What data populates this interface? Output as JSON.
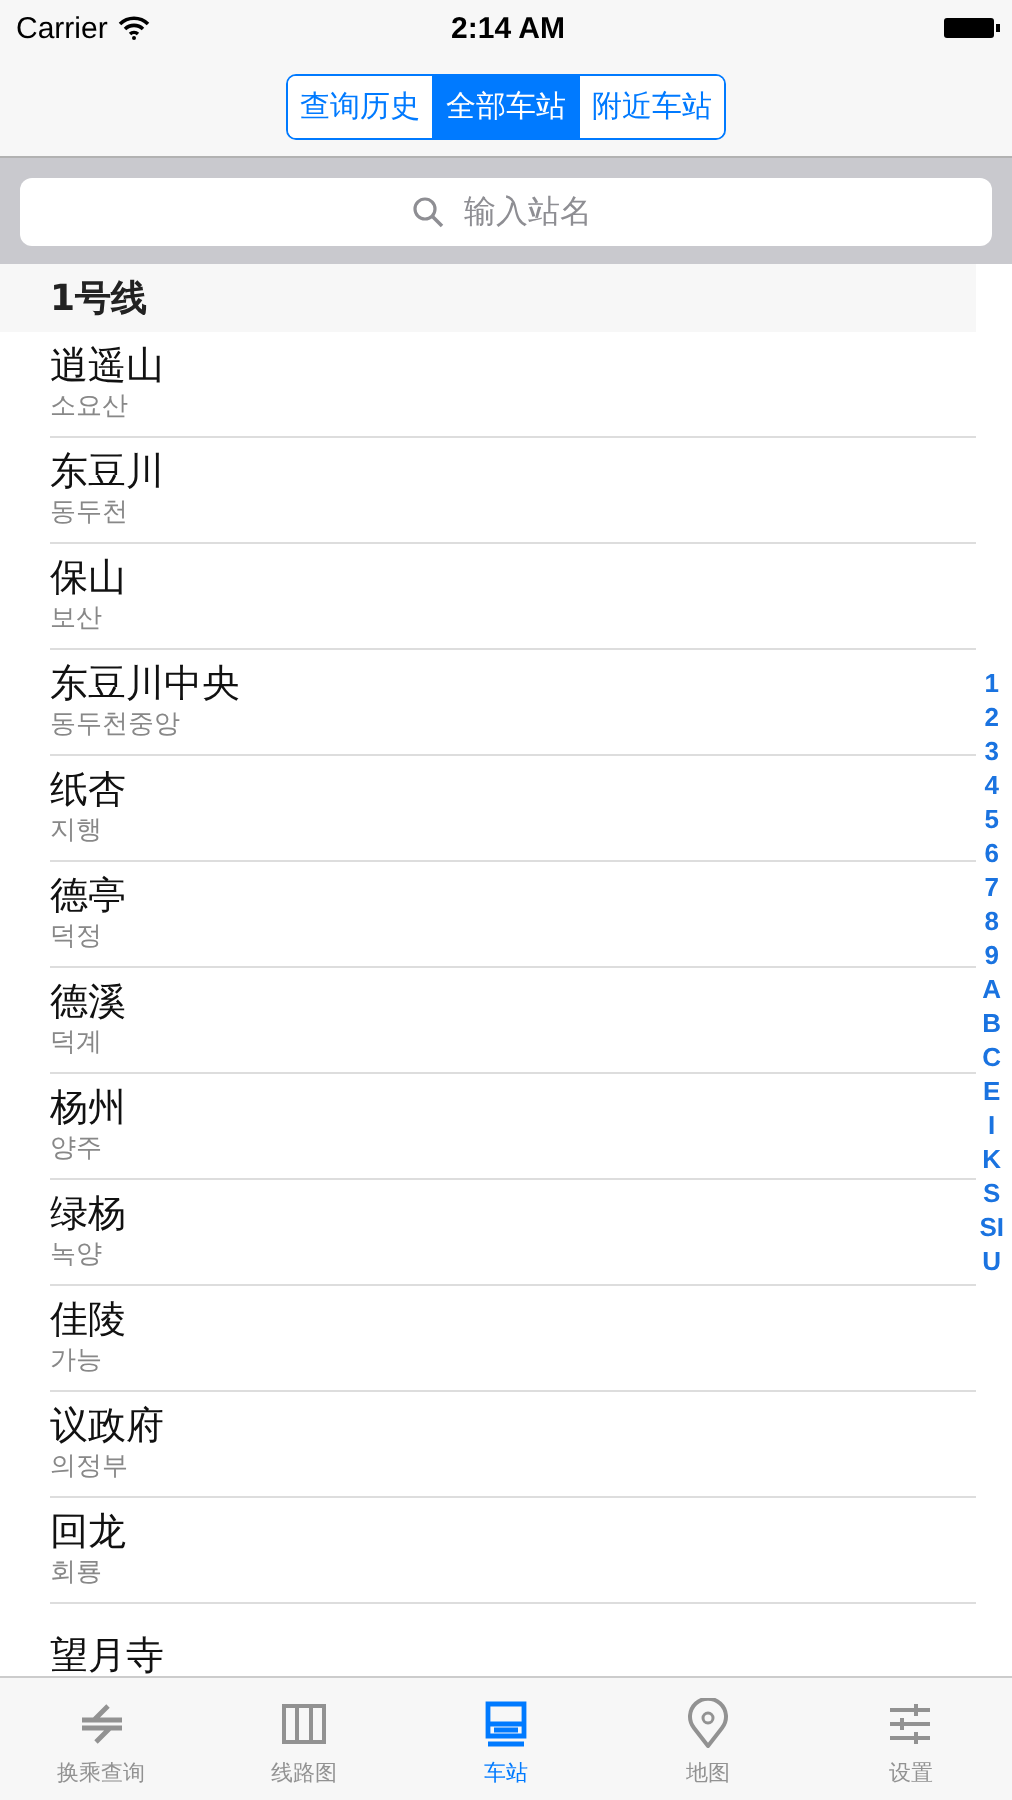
{
  "status_bar": {
    "carrier": "Carrier",
    "time": "2:14 AM"
  },
  "segments": [
    {
      "label": "查询历史",
      "selected": false
    },
    {
      "label": "全部车站",
      "selected": true
    },
    {
      "label": "附近车站",
      "selected": false
    }
  ],
  "search": {
    "placeholder": "输入站名"
  },
  "section": {
    "title": "1号线"
  },
  "stations": [
    {
      "name": "逍遥山",
      "korean": "소요산"
    },
    {
      "name": "东豆川",
      "korean": "동두천"
    },
    {
      "name": "保山",
      "korean": "보산"
    },
    {
      "name": "东豆川中央",
      "korean": "동두천중앙"
    },
    {
      "name": "纸杏",
      "korean": "지행"
    },
    {
      "name": "德亭",
      "korean": "덕정"
    },
    {
      "name": "德溪",
      "korean": "덕계"
    },
    {
      "name": "杨州",
      "korean": "양주"
    },
    {
      "name": "绿杨",
      "korean": "녹양"
    },
    {
      "name": "佳陵",
      "korean": "가능"
    },
    {
      "name": "议政府",
      "korean": "의정부"
    },
    {
      "name": "回龙",
      "korean": "회룡"
    },
    {
      "name": "望月寺"
    }
  ],
  "index": [
    "1",
    "2",
    "3",
    "4",
    "5",
    "6",
    "7",
    "8",
    "9",
    "A",
    "B",
    "C",
    "E",
    "I",
    "K",
    "S",
    "SI",
    "U"
  ],
  "tabs": [
    {
      "kind": "transfer",
      "label": "换乘查询",
      "selected": false
    },
    {
      "kind": "lines",
      "label": "线路图",
      "selected": false
    },
    {
      "kind": "stations",
      "label": "车站",
      "selected": true
    },
    {
      "kind": "map",
      "label": "地图",
      "selected": false
    },
    {
      "kind": "settings",
      "label": "设置",
      "selected": false
    }
  ]
}
